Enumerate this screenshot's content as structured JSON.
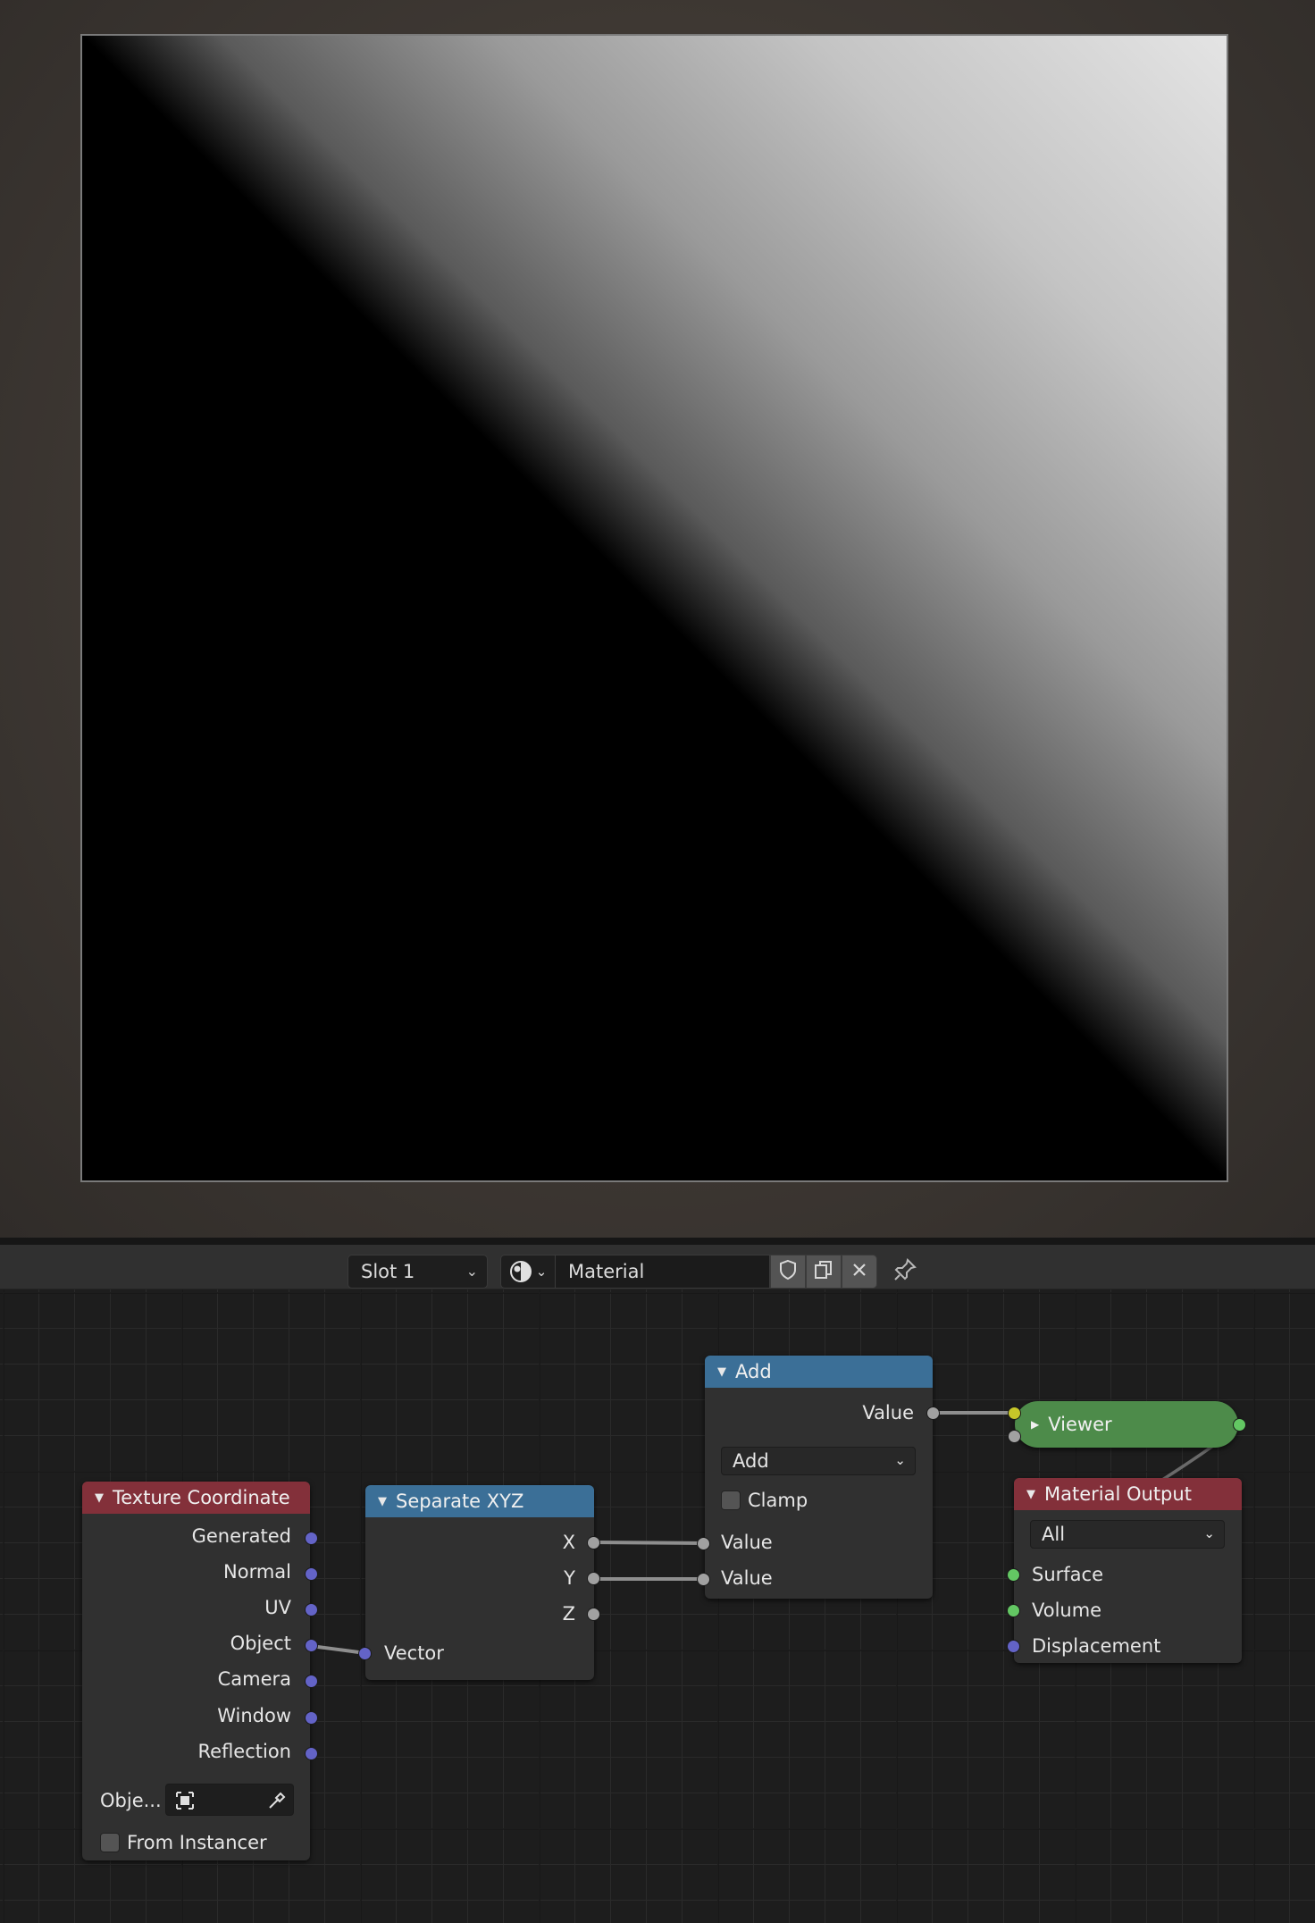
{
  "header": {
    "slot_label": "Slot 1",
    "material_name": "Material",
    "icons": [
      "material-sphere-icon",
      "chevron-down-icon",
      "shield-icon",
      "duplicate-icon",
      "close-icon",
      "pin-icon"
    ]
  },
  "nodes": {
    "texture_coordinate": {
      "title": "Texture Coordinate",
      "outputs": [
        "Generated",
        "Normal",
        "UV",
        "Object",
        "Camera",
        "Window",
        "Reflection"
      ],
      "object_label": "Obje...",
      "from_instancer_label": "From Instancer"
    },
    "separate_xyz": {
      "title": "Separate XYZ",
      "outputs": [
        "X",
        "Y",
        "Z"
      ],
      "input": "Vector"
    },
    "add": {
      "title": "Add",
      "output": "Value",
      "operation": "Add",
      "clamp_label": "Clamp",
      "inputs": [
        "Value",
        "Value"
      ]
    },
    "viewer": {
      "title": "Viewer"
    },
    "material_output": {
      "title": "Material Output",
      "target": "All",
      "inputs": [
        "Surface",
        "Volume",
        "Displacement"
      ]
    }
  },
  "colors": {
    "node_header_input": "#83303a",
    "node_header_converter": "#3b6f97",
    "viewer_node": "#4d8b4a",
    "socket_vector": "#6363c7",
    "socket_value": "#a1a1a1",
    "socket_shader": "#63c763",
    "socket_color": "#c7c729"
  }
}
